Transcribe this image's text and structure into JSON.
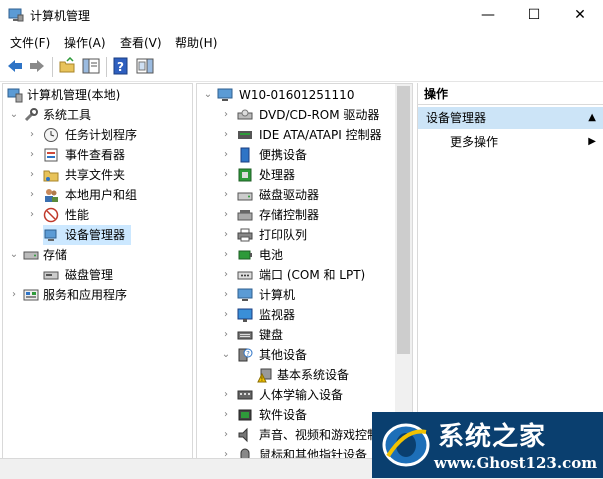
{
  "window": {
    "title": "计算机管理",
    "minimize": "—",
    "maximize": "☐",
    "close": "✕"
  },
  "menu": [
    "文件(F)",
    "操作(A)",
    "查看(V)",
    "帮助(H)"
  ],
  "left_tree": {
    "root": "计算机管理(本地)",
    "system_tools": "系统工具",
    "items": [
      "任务计划程序",
      "事件查看器",
      "共享文件夹",
      "本地用户和组",
      "性能",
      "设备管理器"
    ],
    "storage": "存储",
    "disk_mgmt": "磁盘管理",
    "services": "服务和应用程序"
  },
  "device_tree": {
    "computer_name": "W10-01601251110",
    "categories": [
      "DVD/CD-ROM 驱动器",
      "IDE ATA/ATAPI 控制器",
      "便携设备",
      "处理器",
      "磁盘驱动器",
      "存储控制器",
      "打印队列",
      "电池",
      "端口 (COM 和 LPT)",
      "计算机",
      "监视器",
      "键盘",
      "其他设备"
    ],
    "other_child": "基本系统设备",
    "after": [
      "人体学输入设备",
      "软件设备",
      "声音、视频和游戏控制器",
      "鼠标和其他指针设备"
    ]
  },
  "actions": {
    "title": "操作",
    "section": "设备管理器",
    "more": "更多操作"
  },
  "watermark": {
    "name": "系统之家",
    "url": "www.Ghost123.com"
  }
}
